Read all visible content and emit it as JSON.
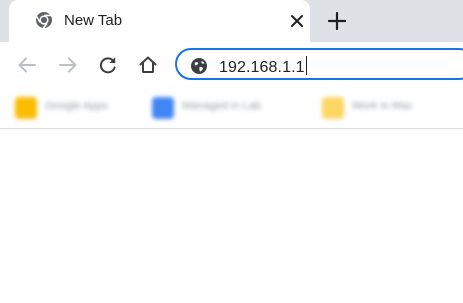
{
  "tab": {
    "title": "New Tab"
  },
  "toolbar": {
    "back_icon": "arrow-left-icon",
    "forward_icon": "arrow-right-icon",
    "reload_icon": "reload-icon",
    "home_icon": "home-icon"
  },
  "omnibox": {
    "value": "192.168.1.1",
    "site_icon": "globe-icon"
  },
  "bookmarks": [
    {
      "label": "Google Apps",
      "color": "#fbbc04"
    },
    {
      "label": "Managed in Lab",
      "color": "#4285f4"
    },
    {
      "label": "Work in Mac",
      "color": "#fdd663"
    }
  ],
  "colors": {
    "tabstrip": "#dee1e6",
    "accent": "#1a73e8",
    "icon": "#5f6368"
  }
}
